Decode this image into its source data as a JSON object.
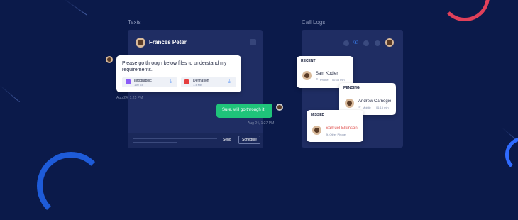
{
  "texts_section": {
    "title": "Texts",
    "contact_name": "Frances Peter",
    "incoming_message": "Please go through below files to understand my requirements.",
    "attachments": [
      {
        "name": "Infographic",
        "size": "150 KB",
        "icon": "image-file-icon",
        "color": "#8b5cf6"
      },
      {
        "name": "Defination",
        "size": "1.4 MB",
        "icon": "pdf-file-icon",
        "color": "#e53e3e"
      }
    ],
    "incoming_time": "Aug 24, 1:25 PM",
    "outgoing_message": "Sure, will go through it",
    "outgoing_time": "Aug 24, 1:27 PM",
    "send_label": "Send",
    "schedule_label": "Schedule"
  },
  "call_logs_section": {
    "title": "Call Logs",
    "recent": {
      "header": "RECENT",
      "name": "Sam Kodler",
      "type": "Phone",
      "duration": "02:33 min"
    },
    "pending": {
      "header": "PENDING",
      "name": "Andrew Carnegie",
      "type": "Mobile",
      "duration": "01:15 min"
    },
    "missed": {
      "header": "MISSED",
      "name": "Samuel Elkinson",
      "detail": "Jt. Other Phone"
    }
  },
  "colors": {
    "background": "#0b1a4a",
    "panel": "#1f2d63",
    "accent_green": "#1fc47a",
    "missed_red": "#e0524f",
    "active_icon": "#3b82f6"
  }
}
